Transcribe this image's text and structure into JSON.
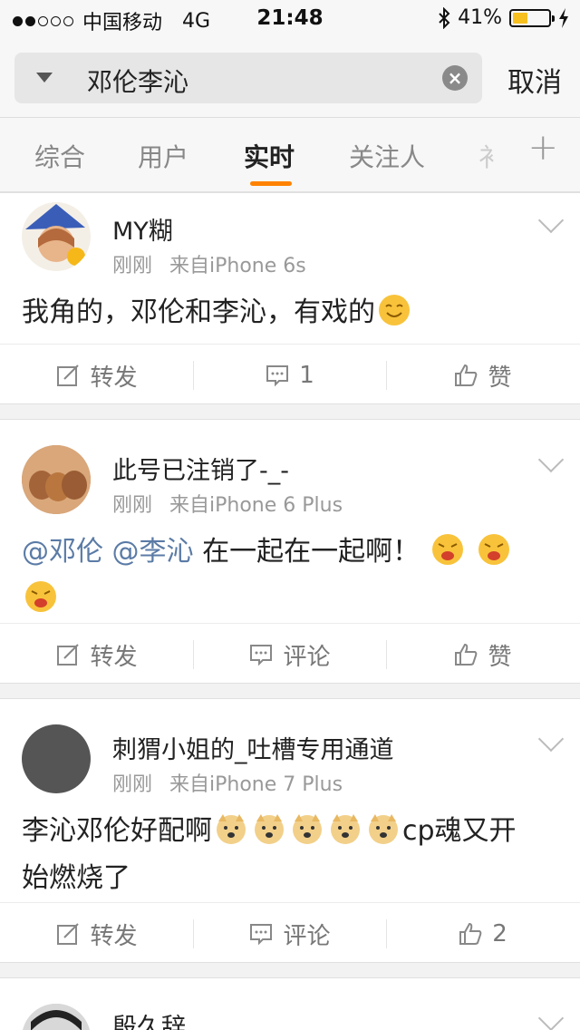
{
  "status_bar": {
    "carrier": "中国移动",
    "network": "4G",
    "time": "21:48",
    "battery": "41%",
    "battery_level": 0.41
  },
  "search": {
    "query": "邓伦李沁",
    "cancel_label": "取消"
  },
  "tabs": [
    "综合",
    "用户",
    "实时",
    "关注人"
  ],
  "active_tab": "实时",
  "posts": [
    {
      "user": "MY糊",
      "time": "刚刚",
      "source": "来自iPhone 6s",
      "text": "我角的，邓伦和李沁，有戏的",
      "actions": {
        "repost": "转发",
        "comment": "1",
        "like": "赞"
      }
    },
    {
      "user": "此号已注销了-_-",
      "time": "刚刚",
      "source": "来自iPhone 6 Plus",
      "mention1": "@邓伦",
      "mention2": "@李沁",
      "text": "在一起在一起啊！",
      "actions": {
        "repost": "转发",
        "comment": "评论",
        "like": "赞"
      }
    },
    {
      "user": "刺猬小姐的_吐槽专用通道",
      "time": "刚刚",
      "source": "来自iPhone 7 Plus",
      "text_a": "李沁邓伦好配啊",
      "text_b": "cp魂又开",
      "text_c": "始燃烧了",
      "actions": {
        "repost": "转发",
        "comment": "评论",
        "like": "2"
      }
    },
    {
      "user": "殷久辞"
    }
  ],
  "colors": {
    "accent": "#ff8200",
    "mention": "#5b7ba6"
  }
}
